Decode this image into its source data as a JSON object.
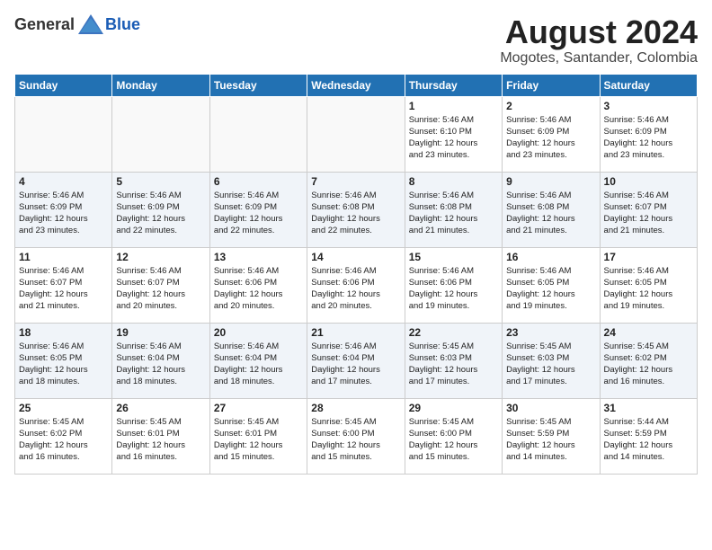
{
  "header": {
    "logo_general": "General",
    "logo_blue": "Blue",
    "month_title": "August 2024",
    "location": "Mogotes, Santander, Colombia"
  },
  "days_of_week": [
    "Sunday",
    "Monday",
    "Tuesday",
    "Wednesday",
    "Thursday",
    "Friday",
    "Saturday"
  ],
  "weeks": [
    [
      {
        "day": "",
        "info": ""
      },
      {
        "day": "",
        "info": ""
      },
      {
        "day": "",
        "info": ""
      },
      {
        "day": "",
        "info": ""
      },
      {
        "day": "1",
        "info": "Sunrise: 5:46 AM\nSunset: 6:10 PM\nDaylight: 12 hours\nand 23 minutes."
      },
      {
        "day": "2",
        "info": "Sunrise: 5:46 AM\nSunset: 6:09 PM\nDaylight: 12 hours\nand 23 minutes."
      },
      {
        "day": "3",
        "info": "Sunrise: 5:46 AM\nSunset: 6:09 PM\nDaylight: 12 hours\nand 23 minutes."
      }
    ],
    [
      {
        "day": "4",
        "info": "Sunrise: 5:46 AM\nSunset: 6:09 PM\nDaylight: 12 hours\nand 23 minutes."
      },
      {
        "day": "5",
        "info": "Sunrise: 5:46 AM\nSunset: 6:09 PM\nDaylight: 12 hours\nand 22 minutes."
      },
      {
        "day": "6",
        "info": "Sunrise: 5:46 AM\nSunset: 6:09 PM\nDaylight: 12 hours\nand 22 minutes."
      },
      {
        "day": "7",
        "info": "Sunrise: 5:46 AM\nSunset: 6:08 PM\nDaylight: 12 hours\nand 22 minutes."
      },
      {
        "day": "8",
        "info": "Sunrise: 5:46 AM\nSunset: 6:08 PM\nDaylight: 12 hours\nand 21 minutes."
      },
      {
        "day": "9",
        "info": "Sunrise: 5:46 AM\nSunset: 6:08 PM\nDaylight: 12 hours\nand 21 minutes."
      },
      {
        "day": "10",
        "info": "Sunrise: 5:46 AM\nSunset: 6:07 PM\nDaylight: 12 hours\nand 21 minutes."
      }
    ],
    [
      {
        "day": "11",
        "info": "Sunrise: 5:46 AM\nSunset: 6:07 PM\nDaylight: 12 hours\nand 21 minutes."
      },
      {
        "day": "12",
        "info": "Sunrise: 5:46 AM\nSunset: 6:07 PM\nDaylight: 12 hours\nand 20 minutes."
      },
      {
        "day": "13",
        "info": "Sunrise: 5:46 AM\nSunset: 6:06 PM\nDaylight: 12 hours\nand 20 minutes."
      },
      {
        "day": "14",
        "info": "Sunrise: 5:46 AM\nSunset: 6:06 PM\nDaylight: 12 hours\nand 20 minutes."
      },
      {
        "day": "15",
        "info": "Sunrise: 5:46 AM\nSunset: 6:06 PM\nDaylight: 12 hours\nand 19 minutes."
      },
      {
        "day": "16",
        "info": "Sunrise: 5:46 AM\nSunset: 6:05 PM\nDaylight: 12 hours\nand 19 minutes."
      },
      {
        "day": "17",
        "info": "Sunrise: 5:46 AM\nSunset: 6:05 PM\nDaylight: 12 hours\nand 19 minutes."
      }
    ],
    [
      {
        "day": "18",
        "info": "Sunrise: 5:46 AM\nSunset: 6:05 PM\nDaylight: 12 hours\nand 18 minutes."
      },
      {
        "day": "19",
        "info": "Sunrise: 5:46 AM\nSunset: 6:04 PM\nDaylight: 12 hours\nand 18 minutes."
      },
      {
        "day": "20",
        "info": "Sunrise: 5:46 AM\nSunset: 6:04 PM\nDaylight: 12 hours\nand 18 minutes."
      },
      {
        "day": "21",
        "info": "Sunrise: 5:46 AM\nSunset: 6:04 PM\nDaylight: 12 hours\nand 17 minutes."
      },
      {
        "day": "22",
        "info": "Sunrise: 5:45 AM\nSunset: 6:03 PM\nDaylight: 12 hours\nand 17 minutes."
      },
      {
        "day": "23",
        "info": "Sunrise: 5:45 AM\nSunset: 6:03 PM\nDaylight: 12 hours\nand 17 minutes."
      },
      {
        "day": "24",
        "info": "Sunrise: 5:45 AM\nSunset: 6:02 PM\nDaylight: 12 hours\nand 16 minutes."
      }
    ],
    [
      {
        "day": "25",
        "info": "Sunrise: 5:45 AM\nSunset: 6:02 PM\nDaylight: 12 hours\nand 16 minutes."
      },
      {
        "day": "26",
        "info": "Sunrise: 5:45 AM\nSunset: 6:01 PM\nDaylight: 12 hours\nand 16 minutes."
      },
      {
        "day": "27",
        "info": "Sunrise: 5:45 AM\nSunset: 6:01 PM\nDaylight: 12 hours\nand 15 minutes."
      },
      {
        "day": "28",
        "info": "Sunrise: 5:45 AM\nSunset: 6:00 PM\nDaylight: 12 hours\nand 15 minutes."
      },
      {
        "day": "29",
        "info": "Sunrise: 5:45 AM\nSunset: 6:00 PM\nDaylight: 12 hours\nand 15 minutes."
      },
      {
        "day": "30",
        "info": "Sunrise: 5:45 AM\nSunset: 5:59 PM\nDaylight: 12 hours\nand 14 minutes."
      },
      {
        "day": "31",
        "info": "Sunrise: 5:44 AM\nSunset: 5:59 PM\nDaylight: 12 hours\nand 14 minutes."
      }
    ]
  ]
}
